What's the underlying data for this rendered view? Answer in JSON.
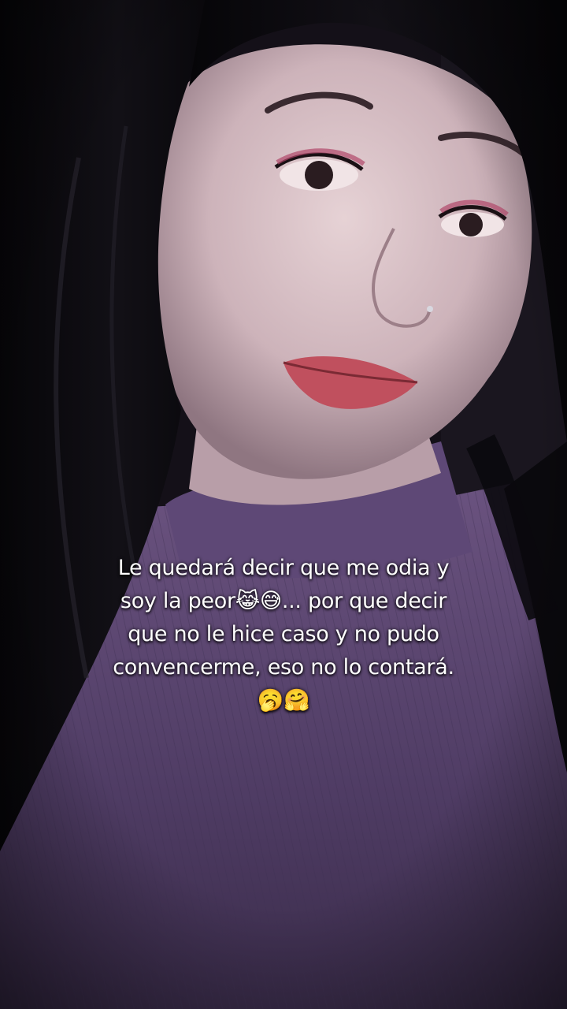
{
  "caption": {
    "line1": "Le quedará decir que me odia y",
    "line2": "soy la peor😹😅... por que decir",
    "line3": "que no le hice caso y no pudo",
    "line4": "convencerme, eso no lo contará.",
    "line5": "🥱🤗"
  },
  "colors": {
    "background": "#0e0a12",
    "hair": "#0a0a0e",
    "skin": "#d9c2c6",
    "sweater": "#5a4570",
    "lips": "#c0505e",
    "text": "#ffffff"
  }
}
